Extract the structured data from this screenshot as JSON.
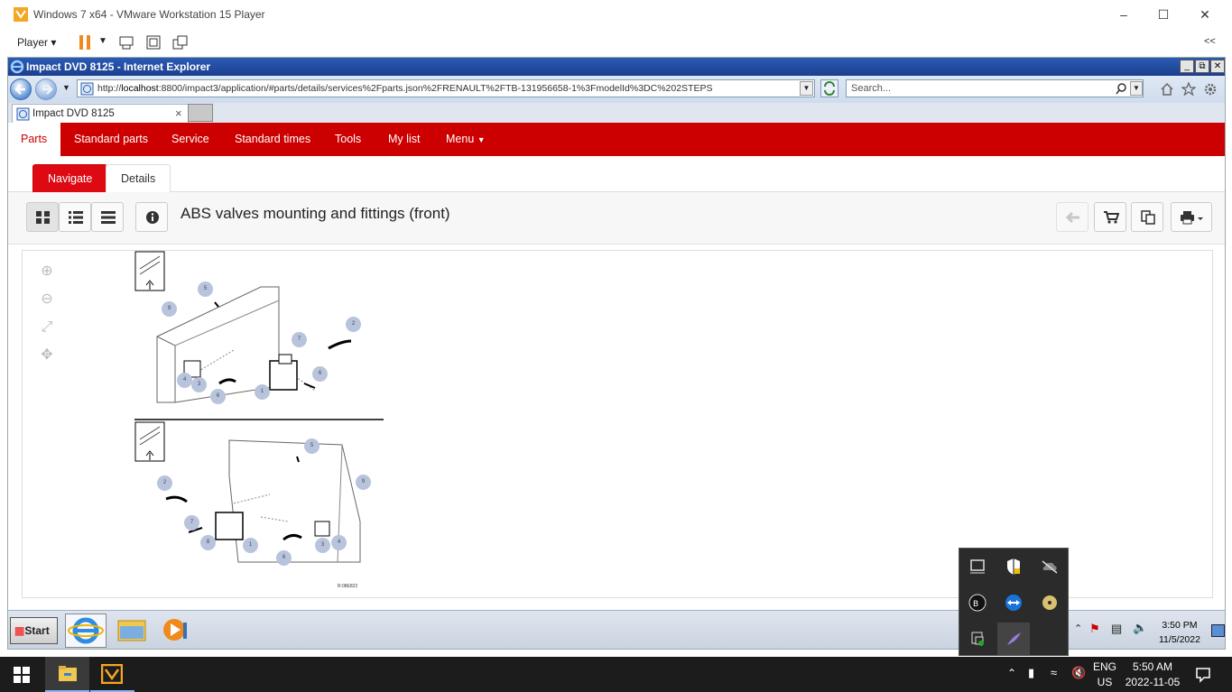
{
  "vmware": {
    "title": "Windows 7 x64 - VMware Workstation 15 Player",
    "player_menu": "Player",
    "collapse": "<<"
  },
  "ie": {
    "window_title": "Impact DVD 8125 - Internet Explorer",
    "url_prefix": "http://",
    "url_host": "localhost",
    "url_rest": ":8800/impact3/application/#parts/details/services%2Fparts.json%2FRENAULT%2FTB-131956658-1%3FmodelId%3DC%202STEPS",
    "search_placeholder": "Search...",
    "tab_label": "Impact DVD 8125"
  },
  "app_nav": {
    "items": [
      "Parts",
      "Standard parts",
      "Service",
      "Standard times",
      "Tools",
      "My list",
      "Menu"
    ]
  },
  "subtabs": {
    "navigate": "Navigate",
    "details": "Details"
  },
  "page": {
    "title": "ABS valves mounting and fittings (front)"
  },
  "drawing": {
    "ref": "R:08E822",
    "callouts_top": [
      "1",
      "2",
      "3",
      "4",
      "5",
      "6",
      "6",
      "7",
      "8",
      "9"
    ],
    "callouts_bottom": [
      "1",
      "2",
      "3",
      "4",
      "5",
      "6",
      "6",
      "7",
      "8",
      "9"
    ]
  },
  "guest_taskbar": {
    "start": "Start",
    "time": "3:50 PM",
    "date": "11/5/2022"
  },
  "host_taskbar": {
    "lang1": "ENG",
    "lang2": "US",
    "time": "5:50 AM",
    "date": "2022-11-05"
  },
  "colors": {
    "app_red": "#cc0000",
    "navigate_red": "#dd0a13",
    "ie_blue": "#2b5bb5"
  }
}
